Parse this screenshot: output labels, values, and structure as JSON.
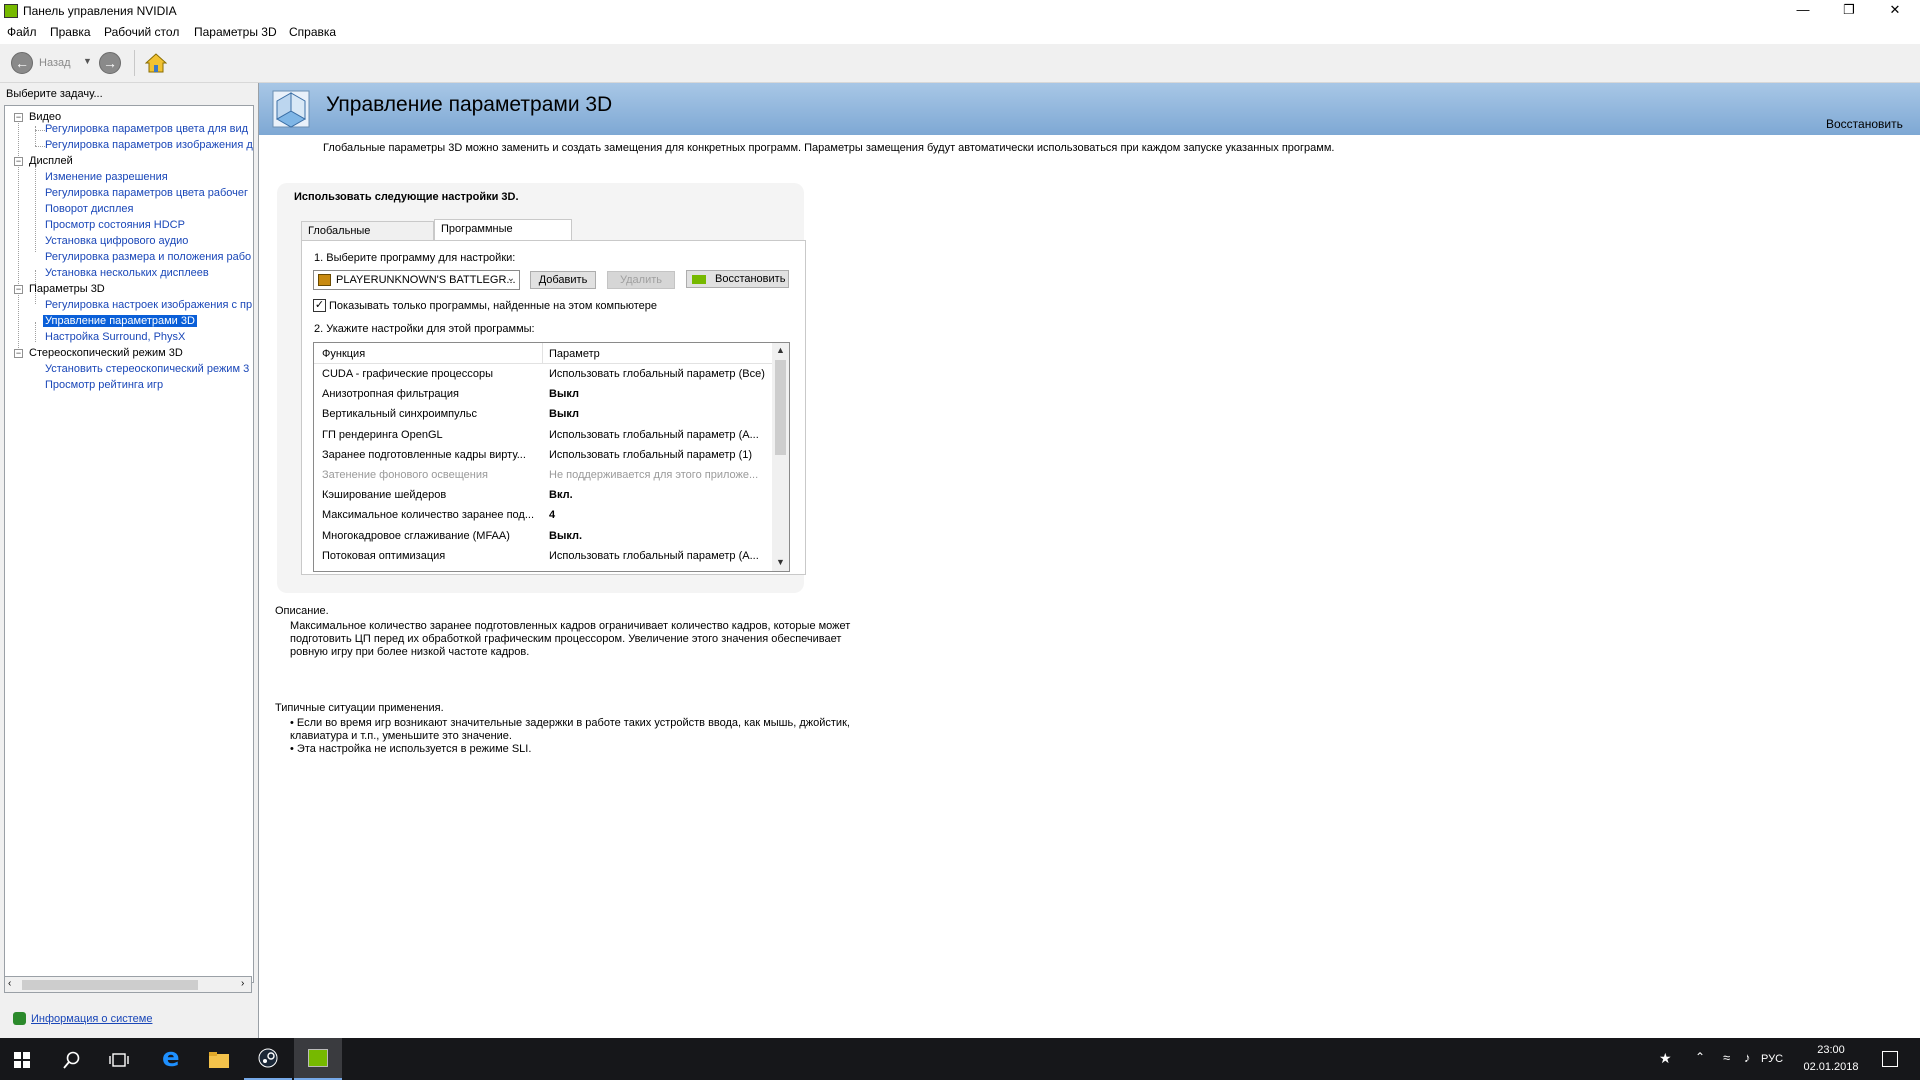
{
  "window": {
    "title": "Панель управления NVIDIA",
    "minimize": "—",
    "maximize": "❐",
    "close": "✕"
  },
  "menu": [
    "Файл",
    "Правка",
    "Рабочий стол",
    "Параметры 3D",
    "Справка"
  ],
  "toolbar": {
    "back_label": "Назад"
  },
  "left": {
    "task_label": "Выберите задачу...",
    "categories": [
      {
        "label": "Видео",
        "items": [
          "Регулировка параметров цвета для вид",
          "Регулировка параметров изображения д"
        ]
      },
      {
        "label": "Дисплей",
        "items": [
          "Изменение разрешения",
          "Регулировка параметров цвета рабочег",
          "Поворот дисплея",
          "Просмотр состояния HDCP",
          "Установка цифрового аудио",
          "Регулировка размера и положения рабо",
          "Установка нескольких дисплеев"
        ]
      },
      {
        "label": "Параметры 3D",
        "items": [
          "Регулировка настроек изображения с пр",
          "Управление параметрами 3D",
          "Настройка Surround, PhysX"
        ]
      },
      {
        "label": "Стереоскопический режим 3D",
        "items": [
          "Установить стереоскопический режим 3",
          "Просмотр рейтинга игр"
        ]
      }
    ],
    "selected_item": "Управление параметрами 3D",
    "system_info": "Информация о системе"
  },
  "main": {
    "title": "Управление параметрами 3D",
    "restore_defaults": "Восстановить",
    "intro": "Глобальные параметры 3D можно заменить и создать замещения для конкретных программ. Параметры замещения будут автоматически использоваться при каждом запуске указанных программ.",
    "use_settings": "Использовать следующие настройки 3D.",
    "tabs": [
      "Глобальные параметры",
      "Программные настройки"
    ],
    "active_tab": "Программные настройки",
    "step1": "1. Выберите программу для настройки:",
    "program": "PLAYERUNKNOWN'S BATTLEGR...",
    "add": "Добавить",
    "remove": "Удалить",
    "restore": "Восстановить",
    "show_only_label": "Показывать только программы, найденные на этом компьютере",
    "show_only_checked": true,
    "step2": "2. Укажите настройки для этой программы:",
    "col_function": "Функция",
    "col_param": "Параметр",
    "rows": [
      {
        "f": "CUDA - графические процессоры",
        "p": "Использовать глобальный параметр (Все)",
        "bold": false,
        "disabled": false
      },
      {
        "f": "Анизотропная фильтрация",
        "p": "Выкл",
        "bold": true,
        "disabled": false
      },
      {
        "f": "Вертикальный синхроимпульс",
        "p": "Выкл",
        "bold": true,
        "disabled": false
      },
      {
        "f": "ГП рендеринга OpenGL",
        "p": "Использовать глобальный параметр (А...",
        "bold": false,
        "disabled": false
      },
      {
        "f": "Заранее подготовленные кадры вирту...",
        "p": "Использовать глобальный параметр (1)",
        "bold": false,
        "disabled": false
      },
      {
        "f": "Затенение фонового освещения",
        "p": "Не поддерживается для этого приложе...",
        "bold": false,
        "disabled": true
      },
      {
        "f": "Кэширование шейдеров",
        "p": "Вкл.",
        "bold": true,
        "disabled": false
      },
      {
        "f": "Максимальное количество заранее под...",
        "p": "4",
        "bold": true,
        "disabled": false
      },
      {
        "f": "Многокадровое сглаживание (MFAA)",
        "p": "Выкл.",
        "bold": true,
        "disabled": false
      },
      {
        "f": "Потоковая оптимизация",
        "p": "Использовать глобальный параметр (А...",
        "bold": false,
        "disabled": false
      }
    ],
    "description_label": "Описание.",
    "description_lines": [
      "Максимальное количество заранее подготовленных кадров ограничивает количество кадров, которые может",
      "подготовить ЦП перед их обработкой графическим процессором. Увеличение этого значения обеспечивает",
      "ровную игру при более низкой частоте кадров."
    ],
    "typical_label": "Типичные ситуации применения.",
    "typical_lines": [
      "• Если во время игр возникают значительные задержки в работе таких устройств ввода, как мышь, джойстик,",
      "клавиатура и т.п., уменьшите это значение.",
      "• Эта настройка не используется в режиме SLI."
    ]
  },
  "taskbar": {
    "lang": "РУС",
    "time": "23:00",
    "date": "02.01.2018"
  },
  "colors": {
    "header_gradient_top": "#a8c7e6",
    "header_gradient_bottom": "#7ea8d4",
    "link": "#1a47b8",
    "selection": "#0a5fd8",
    "nvidia_green": "#76b900",
    "taskbar": "#16171a"
  }
}
